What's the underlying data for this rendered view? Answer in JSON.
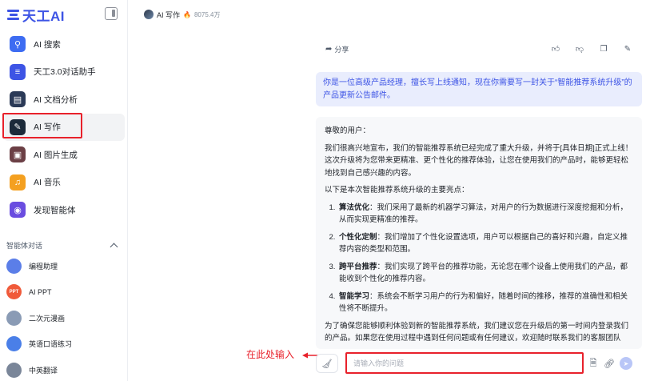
{
  "app": {
    "brand": "天工AI"
  },
  "sidebar": {
    "items": [
      {
        "label": "AI 搜索",
        "icon": "search-icon",
        "color": "#3d6cf2"
      },
      {
        "label": "天工3.0对话助手",
        "icon": "tiangong-icon",
        "color": "#3d54e5"
      },
      {
        "label": "AI 文档分析",
        "icon": "document-icon",
        "color": "#2b3a57"
      },
      {
        "label": "AI 写作",
        "icon": "writing-icon",
        "color": "#1c2a3a"
      },
      {
        "label": "AI 图片生成",
        "icon": "image-icon",
        "color": "#6b3f45"
      },
      {
        "label": "AI 音乐",
        "icon": "music-icon",
        "color": "#f4a020"
      },
      {
        "label": "发现智能体",
        "icon": "agent-discover-icon",
        "color": "#6a4de0"
      }
    ],
    "agents_section": {
      "title": "智能体对话",
      "items": [
        {
          "label": "编程助理",
          "icon": "coding-avatar-icon",
          "color": "#5b7ee8",
          "glyph": ""
        },
        {
          "label": "AI PPT",
          "icon": "ppt-icon",
          "color": "#f05a3a",
          "glyph": "PPT"
        },
        {
          "label": "二次元漫画",
          "icon": "anime-avatar-icon",
          "color": "#8a9bb5",
          "glyph": ""
        },
        {
          "label": "英语口语练习",
          "icon": "english-avatar-icon",
          "color": "#4a7fe8",
          "glyph": ""
        },
        {
          "label": "中英翻译",
          "icon": "translate-avatar-icon",
          "color": "#7a8699",
          "glyph": ""
        }
      ]
    }
  },
  "topbar": {
    "title": "AI 写作",
    "count": "8075.4万"
  },
  "chat": {
    "share_label": "分享",
    "user_message": "你是一位高级产品经理，擅长写上线通知，现在你需要写一封关于“智能推荐系统升级”的产品更新公告邮件。",
    "reply": {
      "greeting": "尊敬的用户：",
      "intro": "我们很高兴地宣布，我们的智能推荐系统已经完成了重大升级，并将于[具体日期]正式上线！这次升级将为您带来更精准、更个性化的推荐体验，让您在使用我们的产品时，能够更轻松地找到自己感兴趣的内容。",
      "highlights_lead": "以下是本次智能推荐系统升级的主要亮点：",
      "highlights": [
        {
          "title": "算法优化",
          "text": "：我们采用了最新的机器学习算法，对用户的行为数据进行深度挖掘和分析，从而实现更精准的推荐。"
        },
        {
          "title": "个性化定制",
          "text": "：我们增加了个性化设置选项，用户可以根据自己的喜好和兴趣，自定义推荐内容的类型和范围。"
        },
        {
          "title": "跨平台推荐",
          "text": "：我们实现了跨平台的推荐功能，无论您在哪个设备上使用我们的产品，都能收到个性化的推荐内容。"
        },
        {
          "title": "智能学习",
          "text": "：系统会不断学习用户的行为和偏好，随着时间的推移，推荐的准确性和相关性将不断提升。"
        }
      ],
      "closing": "为了确保您能够顺利体验到新的智能推荐系统，我们建议您在升级后的第一时间内登录我们的产品。如果您在使用过程中遇到任何问题或有任何建议，欢迎随时联系我们的客服团队"
    }
  },
  "composer": {
    "placeholder": "请输入你的问题",
    "value": "",
    "annotation": "在此处输入"
  },
  "colors": {
    "accent": "#3d54e5",
    "highlight": "#e8212b",
    "user_bubble": "#e9edfd"
  }
}
